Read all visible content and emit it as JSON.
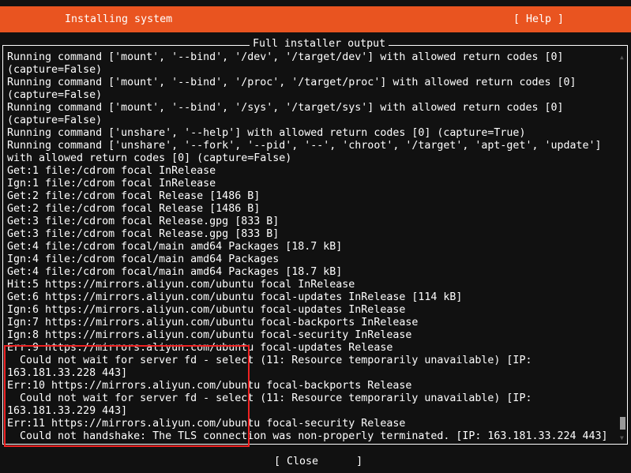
{
  "header": {
    "title": "Installing system",
    "help_label": "[ Help ]",
    "color": "#e95420"
  },
  "panel": {
    "title": "Full installer output"
  },
  "log_lines": [
    "Running command ['mount', '--bind', '/dev', '/target/dev'] with allowed return codes [0]",
    "(capture=False)",
    "Running command ['mount', '--bind', '/proc', '/target/proc'] with allowed return codes [0]",
    "(capture=False)",
    "Running command ['mount', '--bind', '/sys', '/target/sys'] with allowed return codes [0]",
    "(capture=False)",
    "Running command ['unshare', '--help'] with allowed return codes [0] (capture=True)",
    "Running command ['unshare', '--fork', '--pid', '--', 'chroot', '/target', 'apt-get', 'update']",
    "with allowed return codes [0] (capture=False)",
    "Get:1 file:/cdrom focal InRelease",
    "Ign:1 file:/cdrom focal InRelease",
    "Get:2 file:/cdrom focal Release [1486 B]",
    "Get:2 file:/cdrom focal Release [1486 B]",
    "Get:3 file:/cdrom focal Release.gpg [833 B]",
    "Get:3 file:/cdrom focal Release.gpg [833 B]",
    "Get:4 file:/cdrom focal/main amd64 Packages [18.7 kB]",
    "Ign:4 file:/cdrom focal/main amd64 Packages",
    "Get:4 file:/cdrom focal/main amd64 Packages [18.7 kB]",
    "Hit:5 https://mirrors.aliyun.com/ubuntu focal InRelease",
    "Get:6 https://mirrors.aliyun.com/ubuntu focal-updates InRelease [114 kB]",
    "Ign:6 https://mirrors.aliyun.com/ubuntu focal-updates InRelease",
    "Ign:7 https://mirrors.aliyun.com/ubuntu focal-backports InRelease",
    "Ign:8 https://mirrors.aliyun.com/ubuntu focal-security InRelease",
    "Err:9 https://mirrors.aliyun.com/ubuntu focal-updates Release",
    "  Could not wait for server fd - select (11: Resource temporarily unavailable) [IP:",
    "163.181.33.228 443]",
    "Err:10 https://mirrors.aliyun.com/ubuntu focal-backports Release",
    "  Could not wait for server fd - select (11: Resource temporarily unavailable) [IP:",
    "163.181.33.229 443]",
    "Err:11 https://mirrors.aliyun.com/ubuntu focal-security Release",
    "  Could not handshake: The TLS connection was non-properly terminated. [IP: 163.181.33.224 443]"
  ],
  "scroll_position": 1.0,
  "footer": {
    "close_label": "[ Close      ]"
  },
  "annotation": {
    "color": "#ee2222"
  }
}
